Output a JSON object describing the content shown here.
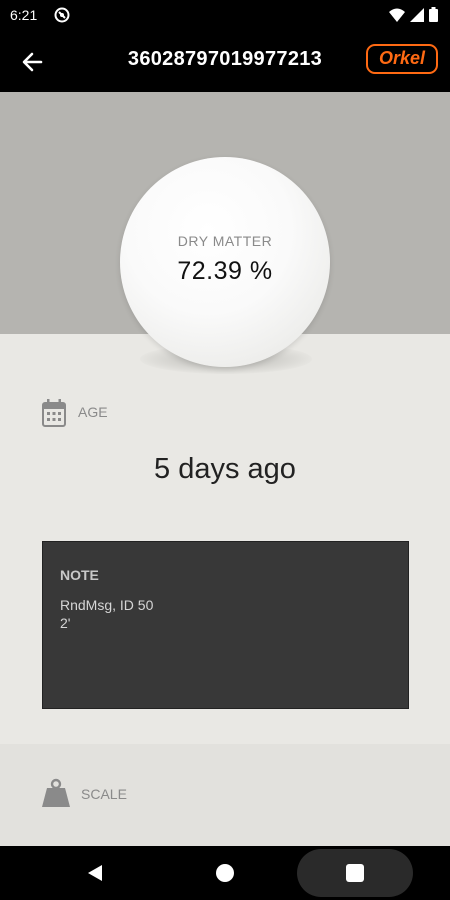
{
  "status_bar": {
    "time": "6:21",
    "icons": [
      "do-not-disturb-icon",
      "wifi-icon",
      "signal-icon",
      "battery-icon"
    ]
  },
  "app_bar": {
    "title": "36028797019977213",
    "brand": "Orkel",
    "brand_color": "#ff6a13"
  },
  "dry_matter": {
    "label": "DRY MATTER",
    "value": "72.39 %"
  },
  "age": {
    "label": "AGE",
    "value": "5 days ago"
  },
  "note": {
    "title": "NOTE",
    "body": "RndMsg, ID 50\n2'"
  },
  "scale": {
    "label": "SCALE"
  },
  "navigation": {
    "buttons": [
      "back-icon",
      "home-icon",
      "recents-icon"
    ]
  }
}
